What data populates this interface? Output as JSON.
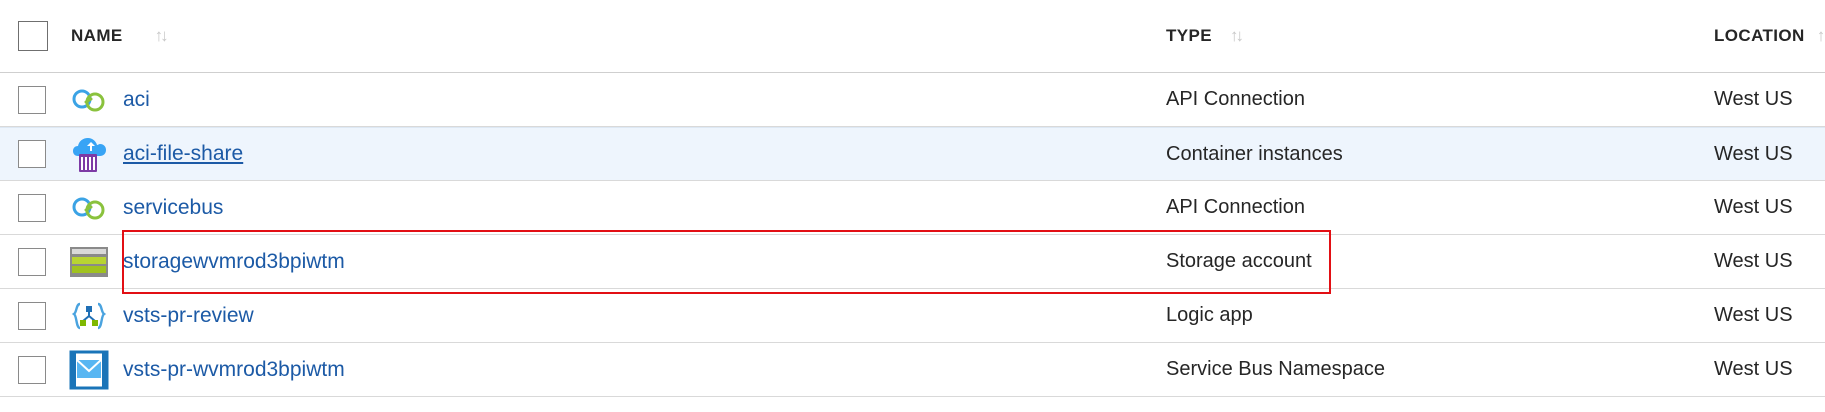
{
  "columns": {
    "name": "NAME",
    "type": "TYPE",
    "location": "LOCATION"
  },
  "sort_glyph": "↑↓",
  "rows": [
    {
      "name": "aci",
      "type": "API Connection",
      "location": "West US",
      "icon": "api-connection-icon"
    },
    {
      "name": "aci-file-share",
      "type": "Container instances",
      "location": "West US",
      "icon": "container-instances-icon",
      "selected": true
    },
    {
      "name": "servicebus",
      "type": "API Connection",
      "location": "West US",
      "icon": "api-connection-icon"
    },
    {
      "name": "storagewvmrod3bpiwtm",
      "type": "Storage account",
      "location": "West US",
      "icon": "storage-account-icon",
      "highlighted": true
    },
    {
      "name": "vsts-pr-review",
      "type": "Logic app",
      "location": "West US",
      "icon": "logic-app-icon"
    },
    {
      "name": "vsts-pr-wvmrod3bpiwtm",
      "type": "Service Bus Namespace",
      "location": "West US",
      "icon": "service-bus-namespace-icon"
    }
  ],
  "colors": {
    "link": "#1c5aa6",
    "selected_row": "#eef5fd",
    "highlight_border": "#e20f14"
  }
}
